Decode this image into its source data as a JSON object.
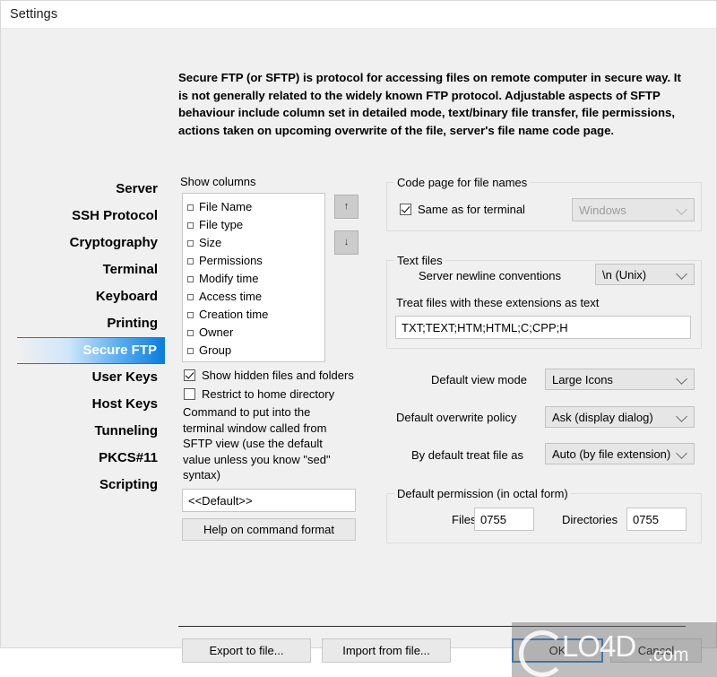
{
  "window": {
    "title": "Settings"
  },
  "description": "Secure FTP (or SFTP) is protocol for accessing files on remote computer in secure way. It is not generally related to the widely known FTP protocol. Adjustable aspects of SFTP behaviour include column set in detailed mode, text/binary file transfer, file permissions, actions taken on upcoming overwrite of the file, server's file name code page.",
  "sidebar": {
    "items": [
      {
        "label": "Server",
        "selected": false
      },
      {
        "label": "SSH Protocol",
        "selected": false
      },
      {
        "label": "Cryptography",
        "selected": false
      },
      {
        "label": "Terminal",
        "selected": false
      },
      {
        "label": "Keyboard",
        "selected": false
      },
      {
        "label": "Printing",
        "selected": false
      },
      {
        "label": "Secure FTP",
        "selected": true
      },
      {
        "label": "User Keys",
        "selected": false
      },
      {
        "label": "Host Keys",
        "selected": false
      },
      {
        "label": "Tunneling",
        "selected": false
      },
      {
        "label": "PKCS#11",
        "selected": false
      },
      {
        "label": "Scripting",
        "selected": false
      }
    ],
    "selected_color": "#0a7de0"
  },
  "left_panel": {
    "show_columns_label": "Show columns",
    "columns": [
      {
        "label": "File Name",
        "checked": false
      },
      {
        "label": "File type",
        "checked": false
      },
      {
        "label": "Size",
        "checked": false
      },
      {
        "label": "Permissions",
        "checked": false
      },
      {
        "label": "Modify time",
        "checked": false
      },
      {
        "label": "Access time",
        "checked": false
      },
      {
        "label": "Creation time",
        "checked": false
      },
      {
        "label": "Owner",
        "checked": false
      },
      {
        "label": "Group",
        "checked": false
      }
    ],
    "move_up_glyph": "↑",
    "move_down_glyph": "↓",
    "show_hidden_label": "Show hidden files and folders",
    "show_hidden_checked": true,
    "restrict_home_label": "Restrict to home directory",
    "restrict_home_checked": false,
    "command_help_text": "Command to put into the terminal window called from SFTP view (use the default value unless you know \"sed\" syntax)",
    "command_value": "<<Default>>",
    "help_button_label": "Help on command format"
  },
  "right_panel": {
    "codepage_group_label": "Code page for file names",
    "same_as_terminal_label": "Same as for terminal",
    "same_as_terminal_checked": true,
    "codepage_value": "Windows",
    "codepage_disabled": true,
    "textfiles_group_label": "Text files",
    "newline_label": "Server newline conventions",
    "newline_value": "\\n (Unix)",
    "extensions_label": "Treat files with these extensions as text",
    "extensions_value": "TXT;TEXT;HTM;HTML;C;CPP;H",
    "view_mode_label": "Default view mode",
    "view_mode_value": "Large Icons",
    "overwrite_label": "Default overwrite policy",
    "overwrite_value": "Ask (display dialog)",
    "treat_file_label": "By default treat file as",
    "treat_file_value": "Auto (by file extension)",
    "permission_group_label": "Default permission (in octal form)",
    "files_label": "Files",
    "files_value": "0755",
    "directories_label": "Directories",
    "directories_value": "0755"
  },
  "footer": {
    "export_label": "Export to file...",
    "import_label": "Import from file...",
    "ok_label": "OK",
    "cancel_label": "Cancel"
  },
  "watermark": {
    "text": "LO4D",
    "suffix": ".com"
  }
}
